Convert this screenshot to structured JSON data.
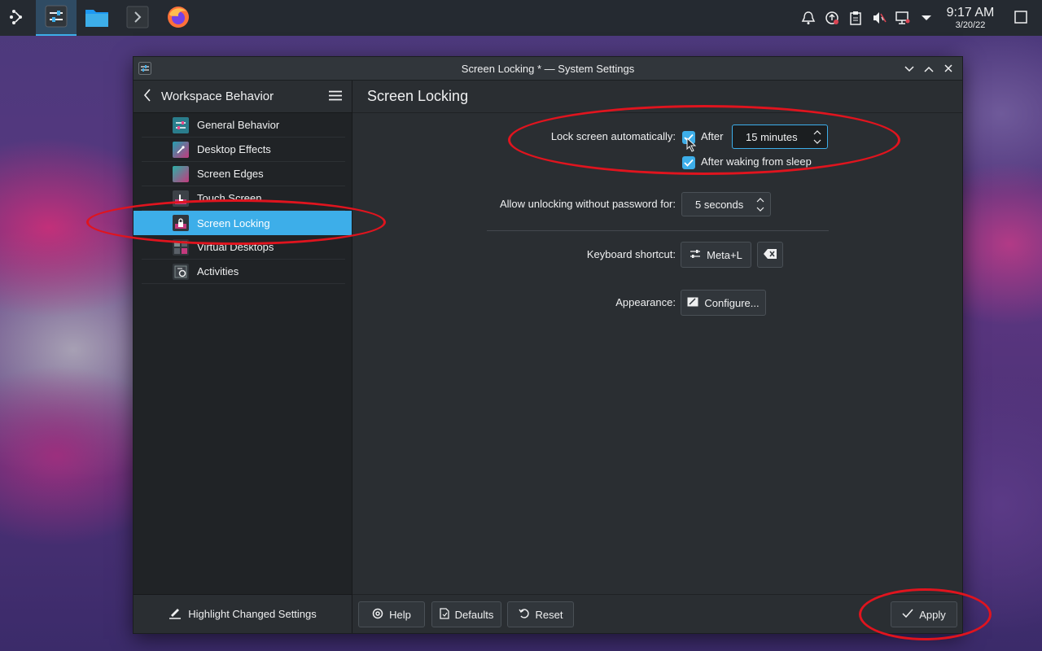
{
  "taskbar": {
    "launcher_icon": "app-launcher-icon",
    "tasks": [
      {
        "name": "system-settings-task",
        "icon": "settings-sliders-icon",
        "active": true
      },
      {
        "name": "file-manager-task",
        "icon": "folder-icon",
        "active": false
      },
      {
        "name": "terminal-task",
        "icon": "terminal-icon",
        "active": false
      },
      {
        "name": "firefox-task",
        "icon": "firefox-icon",
        "active": false
      }
    ],
    "tray_icons": [
      "notifications-icon",
      "update-icon",
      "clipboard-icon",
      "volume-muted-icon",
      "network-icon",
      "expand-tray-icon"
    ],
    "clock": {
      "time": "9:17 AM",
      "date": "3/20/22"
    }
  },
  "window": {
    "title": "Screen Locking * — System Settings",
    "controls": [
      "minimize",
      "maximize",
      "close"
    ]
  },
  "sidebar": {
    "title": "Workspace Behavior",
    "items": [
      {
        "label": "General Behavior",
        "icon": "general-behavior-icon",
        "color": "#1e8a9a"
      },
      {
        "label": "Desktop Effects",
        "icon": "desktop-effects-icon",
        "color": "#23a0b0"
      },
      {
        "label": "Screen Edges",
        "icon": "screen-edges-icon",
        "color": "#2bb0a6"
      },
      {
        "label": "Touch Screen",
        "icon": "touch-screen-icon",
        "color": "#c43a7e"
      },
      {
        "label": "Screen Locking",
        "icon": "screen-locking-icon",
        "color": "#4a4f55",
        "selected": true
      },
      {
        "label": "Virtual Desktops",
        "icon": "virtual-desktops-icon",
        "color": "#5a6068"
      },
      {
        "label": "Activities",
        "icon": "activities-icon",
        "color": "#3d4248"
      }
    ],
    "footer_label": "Highlight Changed Settings"
  },
  "main": {
    "page_title": "Screen Locking",
    "lock_auto_label": "Lock screen automatically:",
    "after_label": "After",
    "after_checked": true,
    "after_value": "15 minutes",
    "after_sleep_label": "After waking from sleep",
    "after_sleep_checked": true,
    "unlock_label": "Allow unlocking without password for:",
    "unlock_value": "5 seconds",
    "shortcut_label": "Keyboard shortcut:",
    "shortcut_value": "Meta+L",
    "appearance_label": "Appearance:",
    "configure_label": "Configure..."
  },
  "footer": {
    "help": "Help",
    "defaults": "Defaults",
    "reset": "Reset",
    "apply": "Apply"
  },
  "colors": {
    "accent": "#3daee9",
    "annotation": "#e0141e"
  }
}
